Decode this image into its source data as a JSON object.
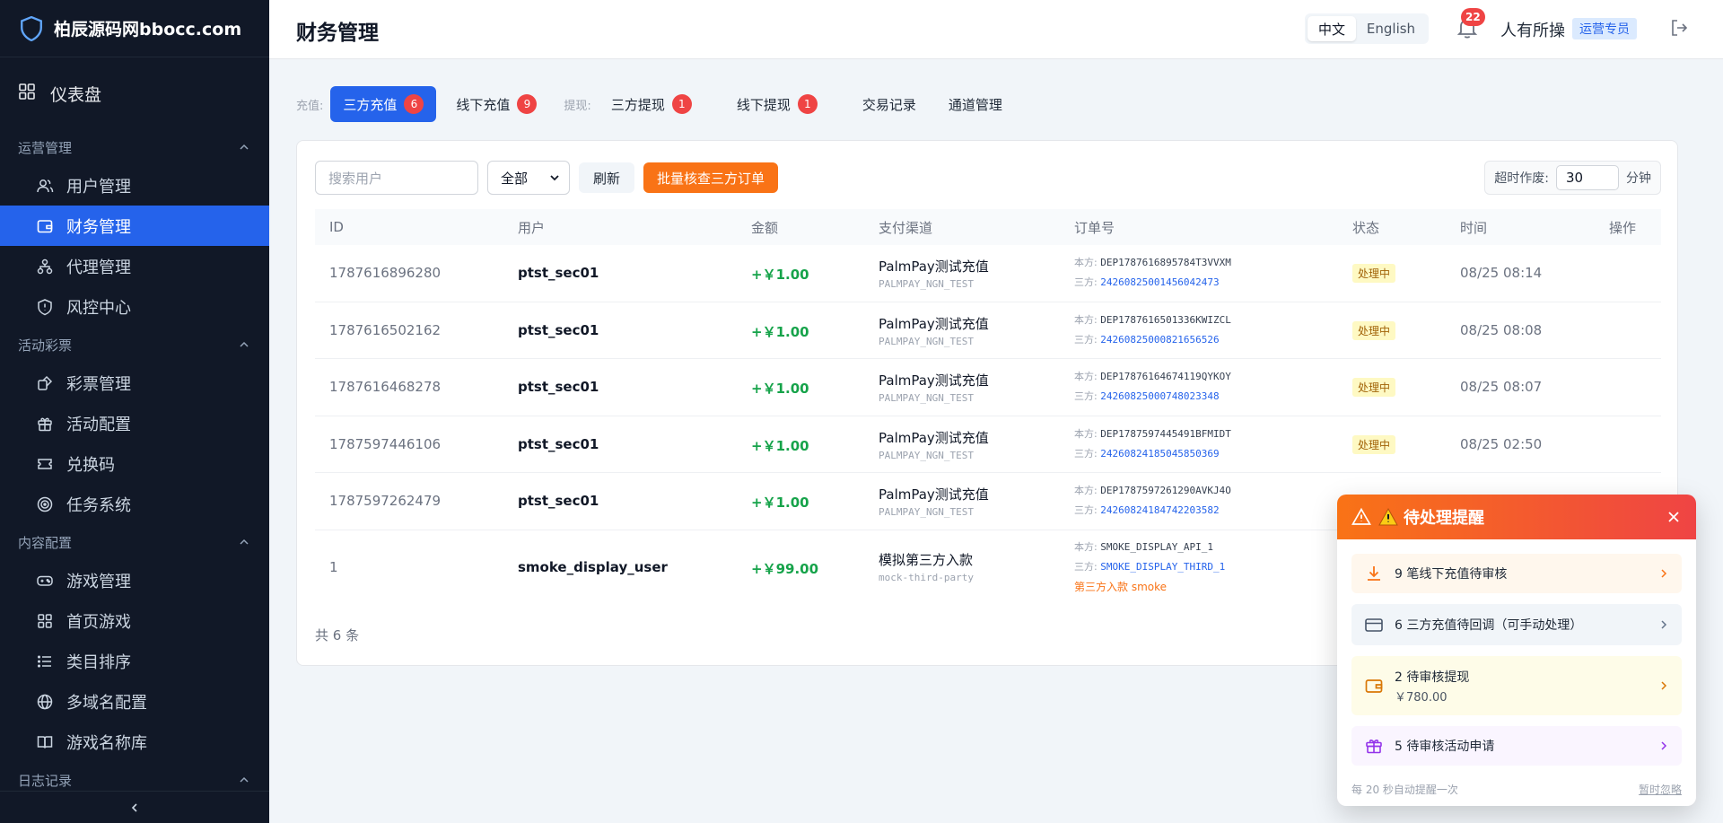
{
  "brand": {
    "name": "柏辰源码网bbocc.com"
  },
  "sidebar": {
    "dashboard": "仪表盘",
    "groups": [
      {
        "title": "运营管理",
        "items": [
          "用户管理",
          "财务管理",
          "代理管理",
          "风控中心"
        ]
      },
      {
        "title": "活动彩票",
        "items": [
          "彩票管理",
          "活动配置",
          "兑换码",
          "任务系统"
        ]
      },
      {
        "title": "内容配置",
        "items": [
          "游戏管理",
          "首页游戏",
          "类目排序",
          "多域名配置",
          "游戏名称库"
        ]
      },
      {
        "title": "日志记录",
        "items": []
      }
    ],
    "active": "财务管理"
  },
  "header": {
    "title": "财务管理",
    "lang_cn": "中文",
    "lang_en": "English",
    "notif_count": "22",
    "user": "人有所操",
    "role": "运营专员"
  },
  "tabs": {
    "recharge_label": "充值:",
    "withdraw_label": "提现:",
    "items": [
      {
        "label": "三方充值",
        "badge": "6"
      },
      {
        "label": "线下充值",
        "badge": "9"
      },
      {
        "label": "三方提现",
        "badge": "1"
      },
      {
        "label": "线下提现",
        "badge": "1"
      },
      {
        "label": "交易记录",
        "badge": ""
      },
      {
        "label": "通道管理",
        "badge": ""
      }
    ]
  },
  "toolbar": {
    "search_placeholder": "搜索用户",
    "filter_value": "全部",
    "refresh": "刷新",
    "batch": "批量核查三方订单",
    "timeout_label": "超时作废:",
    "timeout_value": "30",
    "timeout_unit": "分钟"
  },
  "table": {
    "headers": [
      "ID",
      "用户",
      "金额",
      "支付渠道",
      "订单号",
      "状态",
      "时间",
      "操作"
    ],
    "own_label": "本方:",
    "third_label": "三方:",
    "rows": [
      {
        "id": "1787616896280",
        "user": "ptst_sec01",
        "amount": "+￥1.00",
        "channel": "PalmPay测试充值",
        "code": "PALMPAY_NGN_TEST",
        "own": "DEP1787616895784T3VVXM",
        "third": "24260825001456042473",
        "status": "处理中",
        "time": "08/25 08:14"
      },
      {
        "id": "1787616502162",
        "user": "ptst_sec01",
        "amount": "+￥1.00",
        "channel": "PalmPay测试充值",
        "code": "PALMPAY_NGN_TEST",
        "own": "DEP1787616501336KWIZCL",
        "third": "24260825000821656526",
        "status": "处理中",
        "time": "08/25 08:08"
      },
      {
        "id": "1787616468278",
        "user": "ptst_sec01",
        "amount": "+￥1.00",
        "channel": "PalmPay测试充值",
        "code": "PALMPAY_NGN_TEST",
        "own": "DEP17876164674119QYKOY",
        "third": "24260825000748023348",
        "status": "处理中",
        "time": "08/25 08:07"
      },
      {
        "id": "1787597446106",
        "user": "ptst_sec01",
        "amount": "+￥1.00",
        "channel": "PalmPay测试充值",
        "code": "PALMPAY_NGN_TEST",
        "own": "DEP1787597445491BFMIDT",
        "third": "24260824185045850369",
        "status": "处理中",
        "time": "08/25 02:50"
      },
      {
        "id": "1787597262479",
        "user": "ptst_sec01",
        "amount": "+￥1.00",
        "channel": "PalmPay测试充值",
        "code": "PALMPAY_NGN_TEST",
        "own": "DEP1787597261290AVKJ4O",
        "third": "24260824184742203582",
        "status": "",
        "time": ""
      },
      {
        "id": "1",
        "user": "smoke_display_user",
        "amount": "+￥99.00",
        "channel": "模拟第三方入款",
        "code": "mock-third-party",
        "own": "SMOKE_DISPLAY_API_1",
        "third": "SMOKE_DISPLAY_THIRD_1",
        "note": "第三方入款 smoke",
        "status": "",
        "time": ""
      }
    ],
    "total": "共 6 条"
  },
  "popup": {
    "title": "待处理提醒",
    "items": [
      {
        "text": "9 笔线下充值待审核",
        "sub": ""
      },
      {
        "text": "6 三方充值待回调（可手动处理）",
        "sub": ""
      },
      {
        "text": "2 待审核提现",
        "sub": "￥780.00"
      },
      {
        "text": "5 待审核活动申请",
        "sub": ""
      }
    ],
    "footer": "每 20 秒自动提醒一次",
    "ignore": "暂时忽略"
  }
}
